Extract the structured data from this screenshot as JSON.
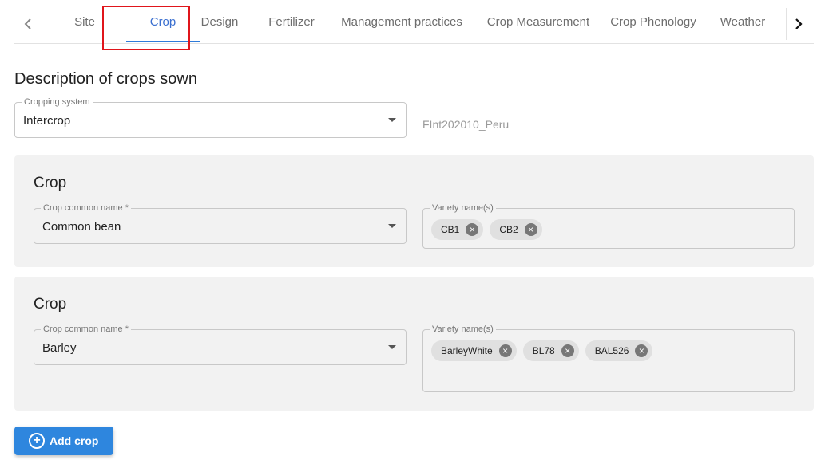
{
  "tabs": [
    {
      "label": "Site"
    },
    {
      "label": "Crop"
    },
    {
      "label": "Design"
    },
    {
      "label": "Fertilizer"
    },
    {
      "label": "Management practices"
    },
    {
      "label": "Crop Measurement"
    },
    {
      "label": "Crop Phenology"
    },
    {
      "label": "Weather"
    }
  ],
  "active_tab": "Crop",
  "section_title": "Description of crops sown",
  "cropping_system": {
    "label": "Cropping system",
    "value": "Intercrop"
  },
  "trial_code": "FInt202010_Peru",
  "crops": [
    {
      "title": "Crop",
      "common_name_label": "Crop common name *",
      "common_name": "Common bean",
      "variety_label": "Variety name(s)",
      "varieties": [
        "CB1",
        "CB2"
      ]
    },
    {
      "title": "Crop",
      "common_name_label": "Crop common name *",
      "common_name": "Barley",
      "variety_label": "Variety name(s)",
      "varieties": [
        "BarleyWhite",
        "BL78",
        "BAL526"
      ]
    }
  ],
  "add_button": {
    "label": "Add crop",
    "icon": "add-circle-icon"
  },
  "colors": {
    "accent": "#2e86de",
    "highlight": "#e0151b",
    "card_bg": "#f2f2f2"
  }
}
